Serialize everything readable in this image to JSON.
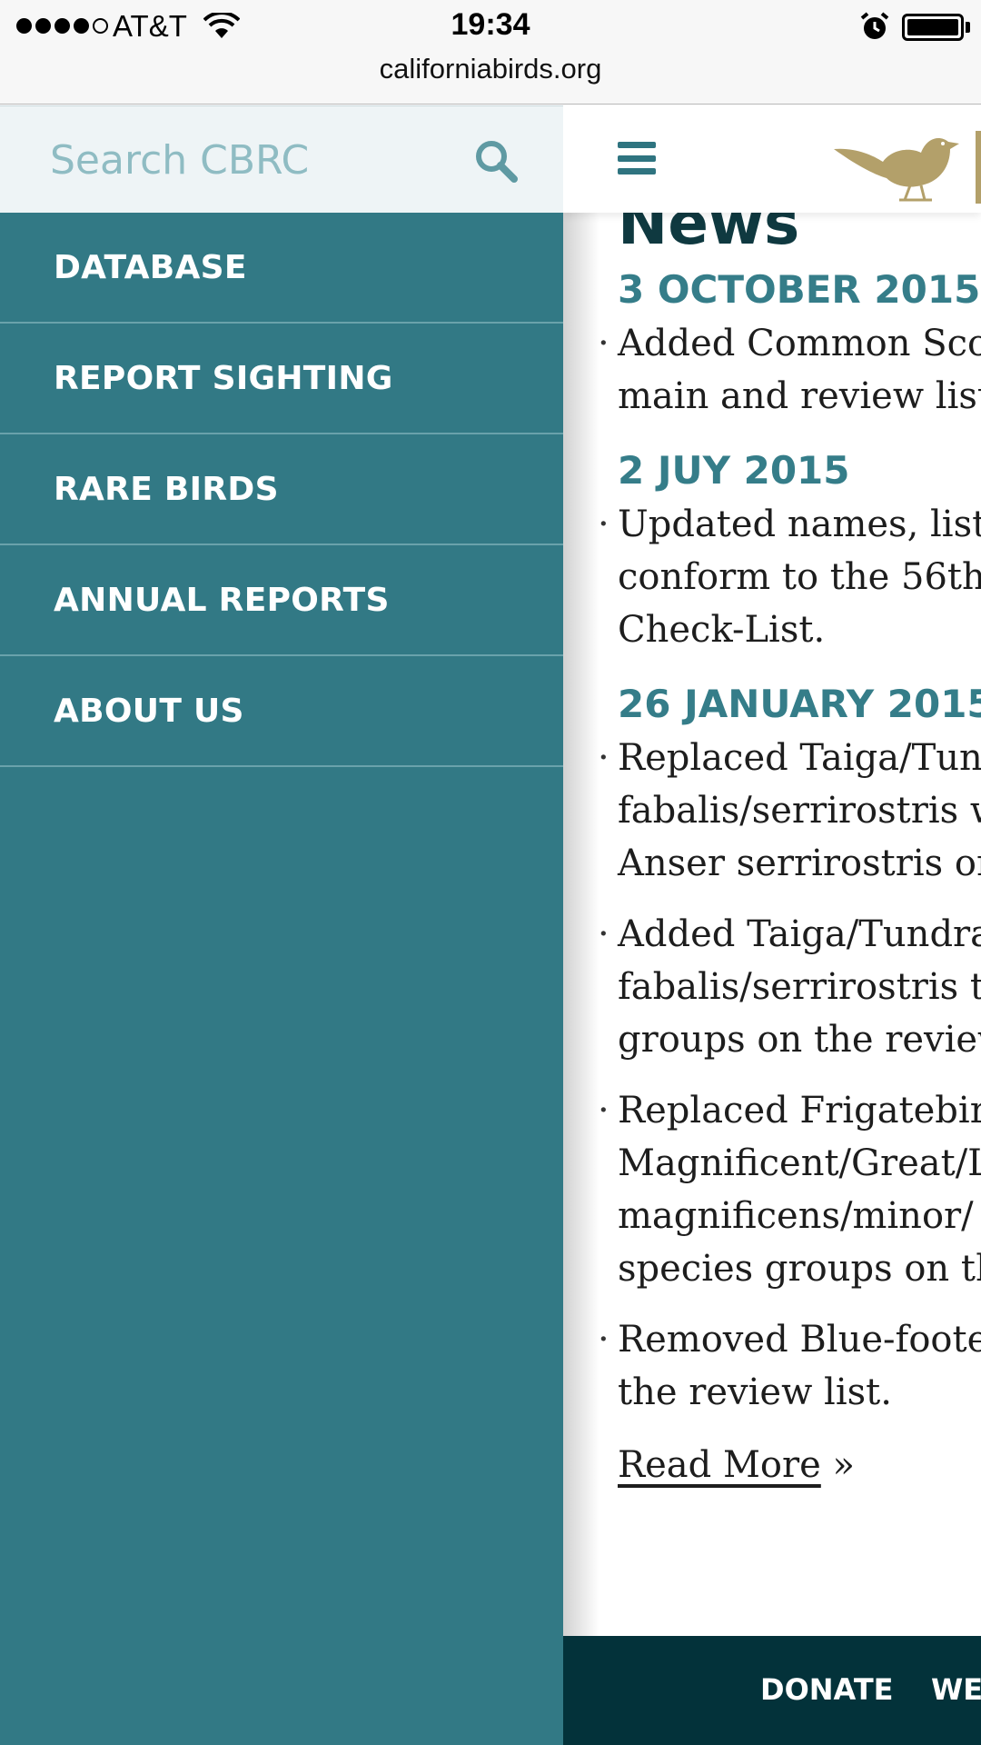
{
  "status_bar": {
    "carrier": "AT&T",
    "time": "19:34",
    "url": "californiabirds.org"
  },
  "sidebar": {
    "search_placeholder": "Search CBRC",
    "items": [
      {
        "label": "DATABASE"
      },
      {
        "label": "REPORT SIGHTING"
      },
      {
        "label": "RARE BIRDS"
      },
      {
        "label": "ANNUAL REPORTS"
      },
      {
        "label": "ABOUT US"
      }
    ]
  },
  "main": {
    "heading": "News",
    "groups": [
      {
        "date": "3 OCTOBER 2015",
        "entries": [
          "Added Common Sco\nmain and review list"
        ]
      },
      {
        "date": "2 JUY 2015",
        "entries": [
          "Updated names, list\nconform to the 56th\nCheck-List."
        ]
      },
      {
        "date": "26 JANUARY 2015",
        "entries": [
          "Replaced Taiga/Tund\nfabalis/serrirostris w\nAnser serrirostris on",
          "Added Taiga/Tundra\nfabalis/serrirostris to\ngroups on the review",
          "Replaced Frigatebird\nMagnificent/Great/L\nmagnificens/minor/\nspecies groups on th",
          "Removed Blue-foote\nthe review list."
        ]
      }
    ],
    "read_more": "Read More",
    "read_more_suffix": "»"
  },
  "footer": {
    "links": [
      {
        "label": "DONATE"
      },
      {
        "label": "WE"
      }
    ]
  },
  "colors": {
    "sidebar_bg": "#327985",
    "accent_teal": "#357d89",
    "footer_bg": "#03323a",
    "logo_gold": "#b3a06a"
  },
  "icons": [
    "wifi-icon",
    "alarm-icon",
    "battery-icon",
    "search-icon",
    "hamburger-menu-icon",
    "bird-logo-icon"
  ]
}
